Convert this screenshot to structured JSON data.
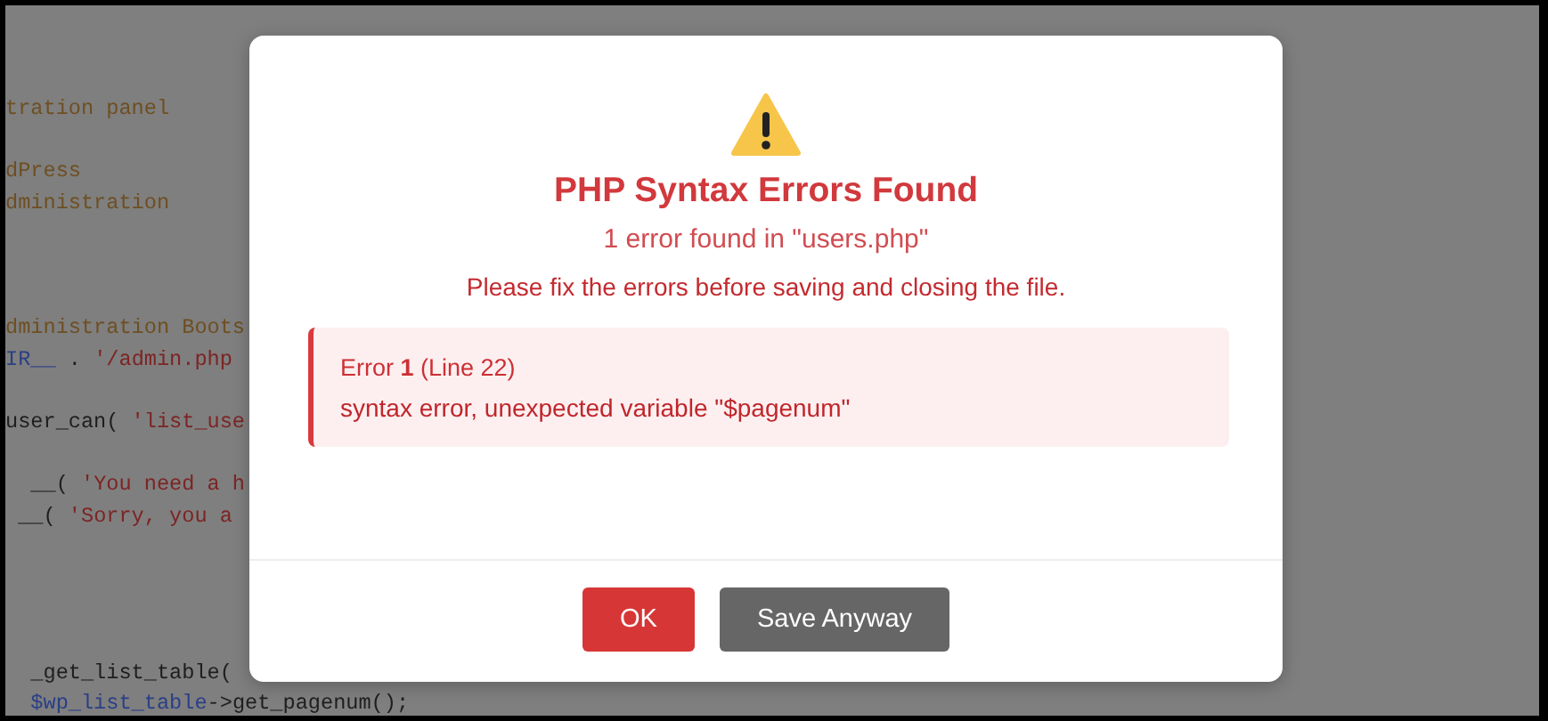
{
  "editor": {
    "lines": [
      {
        "kind": "code",
        "segments": [
          {
            "kind": "comment",
            "text": "tration panel"
          }
        ]
      },
      {
        "kind": "blank"
      },
      {
        "kind": "code",
        "segments": [
          {
            "kind": "comment",
            "text": "dPress"
          }
        ]
      },
      {
        "kind": "code",
        "segments": [
          {
            "kind": "comment",
            "text": "dministration"
          }
        ]
      },
      {
        "kind": "blank"
      },
      {
        "kind": "blank"
      },
      {
        "kind": "blank"
      },
      {
        "kind": "code",
        "segments": [
          {
            "kind": "comment",
            "text": "dministration Boots"
          }
        ]
      },
      {
        "kind": "code",
        "segments": [
          {
            "kind": "constant",
            "text": "IR__"
          },
          {
            "kind": "plain",
            "text": " . "
          },
          {
            "kind": "string",
            "text": "'/admin.php"
          }
        ]
      },
      {
        "kind": "blank"
      },
      {
        "kind": "code",
        "segments": [
          {
            "kind": "plain",
            "text": "user_can( "
          },
          {
            "kind": "string",
            "text": "'list_use"
          }
        ]
      },
      {
        "kind": "blank"
      },
      {
        "kind": "code",
        "segments": [
          {
            "kind": "plain",
            "text": "  __( "
          },
          {
            "kind": "string",
            "text": "'You need a h"
          }
        ]
      },
      {
        "kind": "code",
        "segments": [
          {
            "kind": "plain",
            "text": " __( "
          },
          {
            "kind": "string",
            "text": "'Sorry, you a"
          }
        ]
      },
      {
        "kind": "blank"
      },
      {
        "kind": "blank"
      },
      {
        "kind": "blank"
      },
      {
        "kind": "blank"
      },
      {
        "kind": "code",
        "segments": [
          {
            "kind": "plain",
            "text": "  _get_list_table("
          }
        ]
      },
      {
        "kind": "code",
        "segments": [
          {
            "kind": "constant",
            "text": "  $wp_list_table"
          },
          {
            "kind": "plain",
            "text": "->get_pagenum();"
          }
        ]
      }
    ]
  },
  "dialog": {
    "title": "PHP Syntax Errors Found",
    "subtitle": "1 error found in \"users.php\"",
    "message": "Please fix the errors before saving and closing the file.",
    "errors": [
      {
        "heading": "Error **1** (Line 22)",
        "text": "syntax error, unexpected variable \"$pagenum\""
      }
    ],
    "buttons": [
      {
        "label": "OK",
        "kind": "primary"
      },
      {
        "label": "Save Anyway",
        "kind": "secondary"
      }
    ]
  }
}
